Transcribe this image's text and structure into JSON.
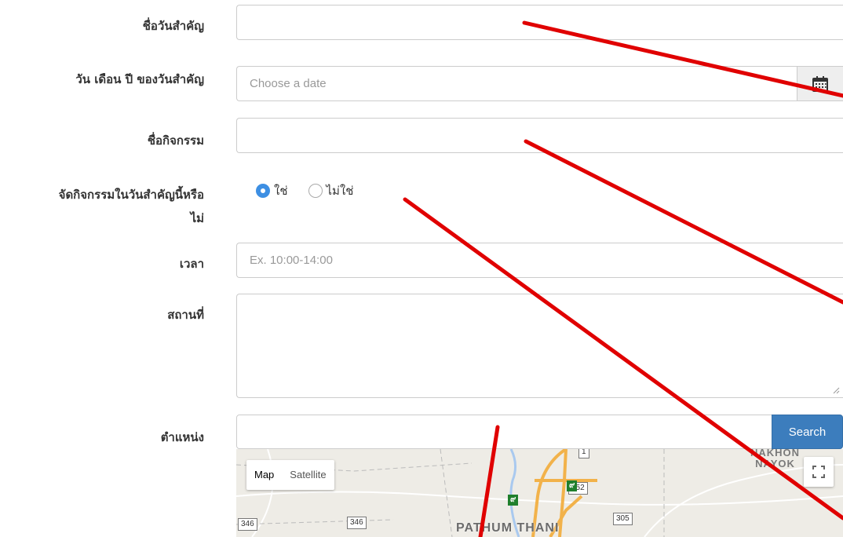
{
  "form": {
    "event_name": {
      "label": "ชื่อวันสำคัญ",
      "value": ""
    },
    "event_date": {
      "label": "วัน เดือน ปี ของวันสำคัญ",
      "placeholder": "Choose a date"
    },
    "activity_name": {
      "label": "ชื่อกิจกรรม",
      "value": ""
    },
    "same_day": {
      "label_line1": "จัดกิจกรรมในวันสำคัญนี้หรือ",
      "label_line2": "ไม่",
      "options": [
        {
          "label": "ใช่",
          "checked": true
        },
        {
          "label": "ไม่ใช่",
          "checked": false
        }
      ]
    },
    "time": {
      "label": "เวลา",
      "placeholder": "Ex. 10:00-14:00"
    },
    "place": {
      "label": "สถานที่",
      "value": ""
    },
    "location": {
      "label": "ตำแหน่ง",
      "value": "",
      "search_label": "Search"
    }
  },
  "map": {
    "type_buttons": [
      "Map",
      "Satellite"
    ],
    "active_type": "Map",
    "city_label": "PATHUM THANI",
    "city2_line1": "NAKHON",
    "city2_line2": "NAYOK",
    "road_shields": [
      "346",
      "346",
      "352",
      "305",
      "1"
    ],
    "green_shields": [
      "๙",
      "๙"
    ]
  },
  "colors": {
    "primary_button": "#3c7dbd",
    "radio_checked": "#3d8fe3",
    "annotation_line": "#e00000"
  }
}
